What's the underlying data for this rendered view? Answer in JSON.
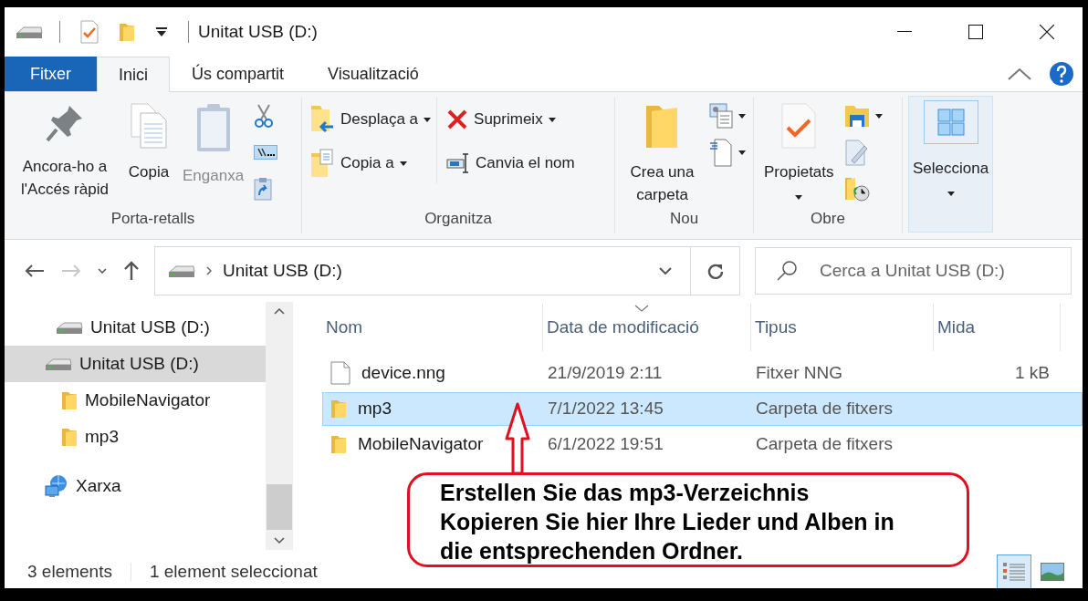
{
  "window": {
    "title": "Unitat USB (D:)"
  },
  "ribbon_tabs": [
    {
      "label": "Fitxer",
      "kind": "file",
      "selected": false
    },
    {
      "label": "Inici",
      "kind": "tab",
      "selected": true
    },
    {
      "label": "Ús compartit",
      "kind": "tab",
      "selected": false
    },
    {
      "label": "Visualització",
      "kind": "tab",
      "selected": false
    }
  ],
  "ribbon_groups": [
    {
      "label": "Porta-retalls",
      "items": [
        {
          "kind": "large",
          "label": "Ancora-ho a l'Accés ràpid",
          "dropdown": false,
          "disabled": false
        },
        {
          "kind": "large",
          "label": "Copia",
          "dropdown": false,
          "disabled": false
        },
        {
          "kind": "large",
          "label": "Enganxa",
          "dropdown": false,
          "disabled": true
        },
        {
          "kind": "stack",
          "commands": [
            {
              "dropdown": false,
              "disabled": false
            },
            {
              "dropdown": false,
              "disabled": false
            },
            {
              "dropdown": false,
              "disabled": false
            }
          ]
        }
      ]
    },
    {
      "label": "Organitza",
      "items": [
        {
          "kind": "stack",
          "commands": [
            {
              "label": "Desplaça a",
              "dropdown": true,
              "disabled": false
            },
            {
              "label": "Copia a",
              "dropdown": true,
              "disabled": false
            }
          ]
        },
        {
          "kind": "stack",
          "commands": [
            {
              "label": "Suprimeix",
              "dropdown": true,
              "disabled": false
            },
            {
              "label": "Canvia el nom",
              "dropdown": false,
              "disabled": false
            }
          ]
        }
      ]
    },
    {
      "label": "Nou",
      "items": [
        {
          "kind": "large",
          "label": "Crea una carpeta",
          "dropdown": false,
          "disabled": false
        },
        {
          "kind": "stack",
          "commands": [
            {
              "dropdown": true,
              "disabled": false
            },
            {
              "dropdown": true,
              "disabled": false
            }
          ]
        }
      ]
    },
    {
      "label": "Obre",
      "items": [
        {
          "kind": "large",
          "label": "Propietats",
          "dropdown": true,
          "disabled": false
        },
        {
          "kind": "stack",
          "commands": [
            {
              "dropdown": true,
              "disabled": false
            },
            {
              "dropdown": false,
              "disabled": false
            },
            {
              "dropdown": false,
              "disabled": false
            }
          ]
        }
      ]
    },
    {
      "items": [
        {
          "kind": "large",
          "label": "Selecciona",
          "dropdown": true,
          "disabled": false,
          "selected": true
        }
      ]
    }
  ],
  "navigation": {
    "back_disabled": false,
    "forward_disabled": true,
    "address": "Unitat USB (D:)",
    "search": {
      "placeholder": "Cerca a Unitat USB (D:)"
    }
  },
  "sidebar": {
    "items": [
      {
        "label": "Unitat USB (D:)",
        "kind": "drive",
        "selected": false
      },
      {
        "label": "Unitat USB (D:)",
        "kind": "drive",
        "selected": true,
        "children": [
          {
            "label": "MobileNavigator",
            "kind": "folder",
            "selected": false
          },
          {
            "label": "mp3",
            "kind": "folder",
            "selected": false
          }
        ]
      },
      {
        "label": "Xarxa",
        "kind": "network",
        "selected": false
      }
    ]
  },
  "file_list": {
    "columns": [
      {
        "label": "Nom",
        "sorted": false
      },
      {
        "label": "Data de modificació",
        "sorted": true
      },
      {
        "label": "Tipus",
        "sorted": false
      },
      {
        "label": "Mida",
        "sorted": false
      }
    ],
    "rows": [
      {
        "kind": "file",
        "name": "device.nng",
        "modified": "21/9/2019 2:11",
        "type": "Fitxer NNG",
        "size": "1 kB",
        "selected": false
      },
      {
        "kind": "folder",
        "name": "mp3",
        "modified": "7/1/2022 13:45",
        "type": "Carpeta de fitxers",
        "selected": true
      },
      {
        "kind": "folder",
        "name": "MobileNavigator",
        "modified": "6/1/2022 19:51",
        "type": "Carpeta de fitxers",
        "selected": false
      }
    ]
  },
  "status_bar": {
    "item_count": "3 elements",
    "selection": "1 element seleccionat",
    "views": [
      {
        "kind": "details",
        "selected": true
      },
      {
        "kind": "large_icons",
        "selected": false
      }
    ]
  },
  "callout": {
    "text": "Erstellen Sie das mp3-Verzeichnis\nKopieren Sie hier Ihre Lieder und Alben in\ndie entsprechenden Ordner."
  }
}
